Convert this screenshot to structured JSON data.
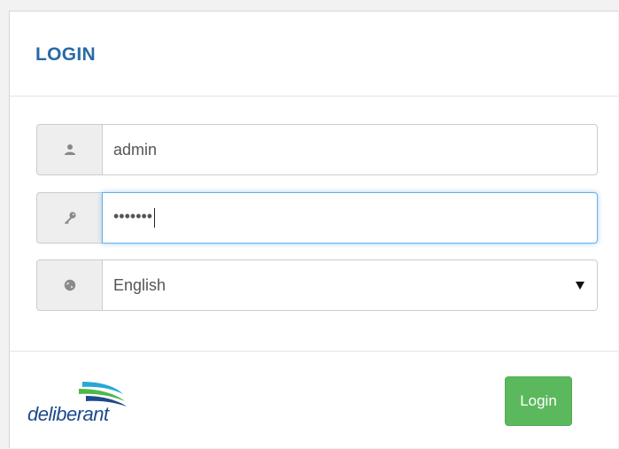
{
  "header": {
    "title": "LOGIN"
  },
  "form": {
    "username": {
      "value": "admin",
      "icon": "user-icon"
    },
    "password": {
      "masked_value": "•••••••",
      "icon": "key-icon"
    },
    "language": {
      "selected": "English",
      "icon": "globe-icon"
    }
  },
  "footer": {
    "brand": "deliberant",
    "login_label": "Login"
  },
  "colors": {
    "title": "#2a6aa6",
    "login_button": "#5cb85c",
    "focus_border": "#66afe9",
    "brand": "#1d4a8a"
  }
}
